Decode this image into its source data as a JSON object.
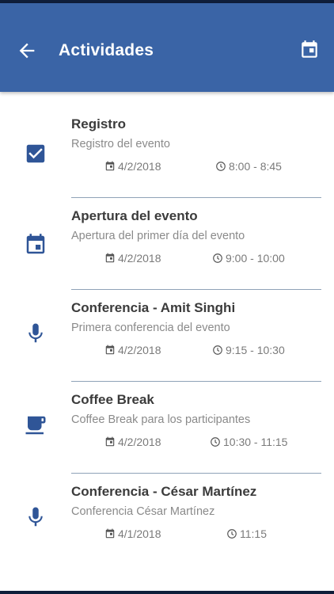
{
  "appbar": {
    "title": "Actividades",
    "back_icon": "arrow-left-icon",
    "calendar_icon": "calendar-icon"
  },
  "colors": {
    "primary": "#3a64a6",
    "icon": "#2f5597",
    "statusbar": "#0f1e3a"
  },
  "activities": [
    {
      "icon": "check-box-icon",
      "name": "Registro",
      "desc": "Registro del evento",
      "date": "4/2/2018",
      "time": "8:00 - 8:45"
    },
    {
      "icon": "event-icon",
      "name": "Apertura del evento",
      "desc": "Apertura del primer día del evento",
      "date": "4/2/2018",
      "time": "9:00 - 10:00"
    },
    {
      "icon": "microphone-icon",
      "name": "Conferencia - Amit Singhi",
      "desc": "Primera conferencia del evento",
      "date": "4/2/2018",
      "time": "9:15 - 10:30"
    },
    {
      "icon": "coffee-icon",
      "name": "Coffee Break",
      "desc": "Coffee Break para los participantes",
      "date": "4/2/2018",
      "time": "10:30 - 11:15"
    },
    {
      "icon": "microphone-icon",
      "name": "Conferencia - César Martínez",
      "desc": "Conferencia César Martínez",
      "date": "4/1/2018",
      "time": "11:15"
    }
  ]
}
